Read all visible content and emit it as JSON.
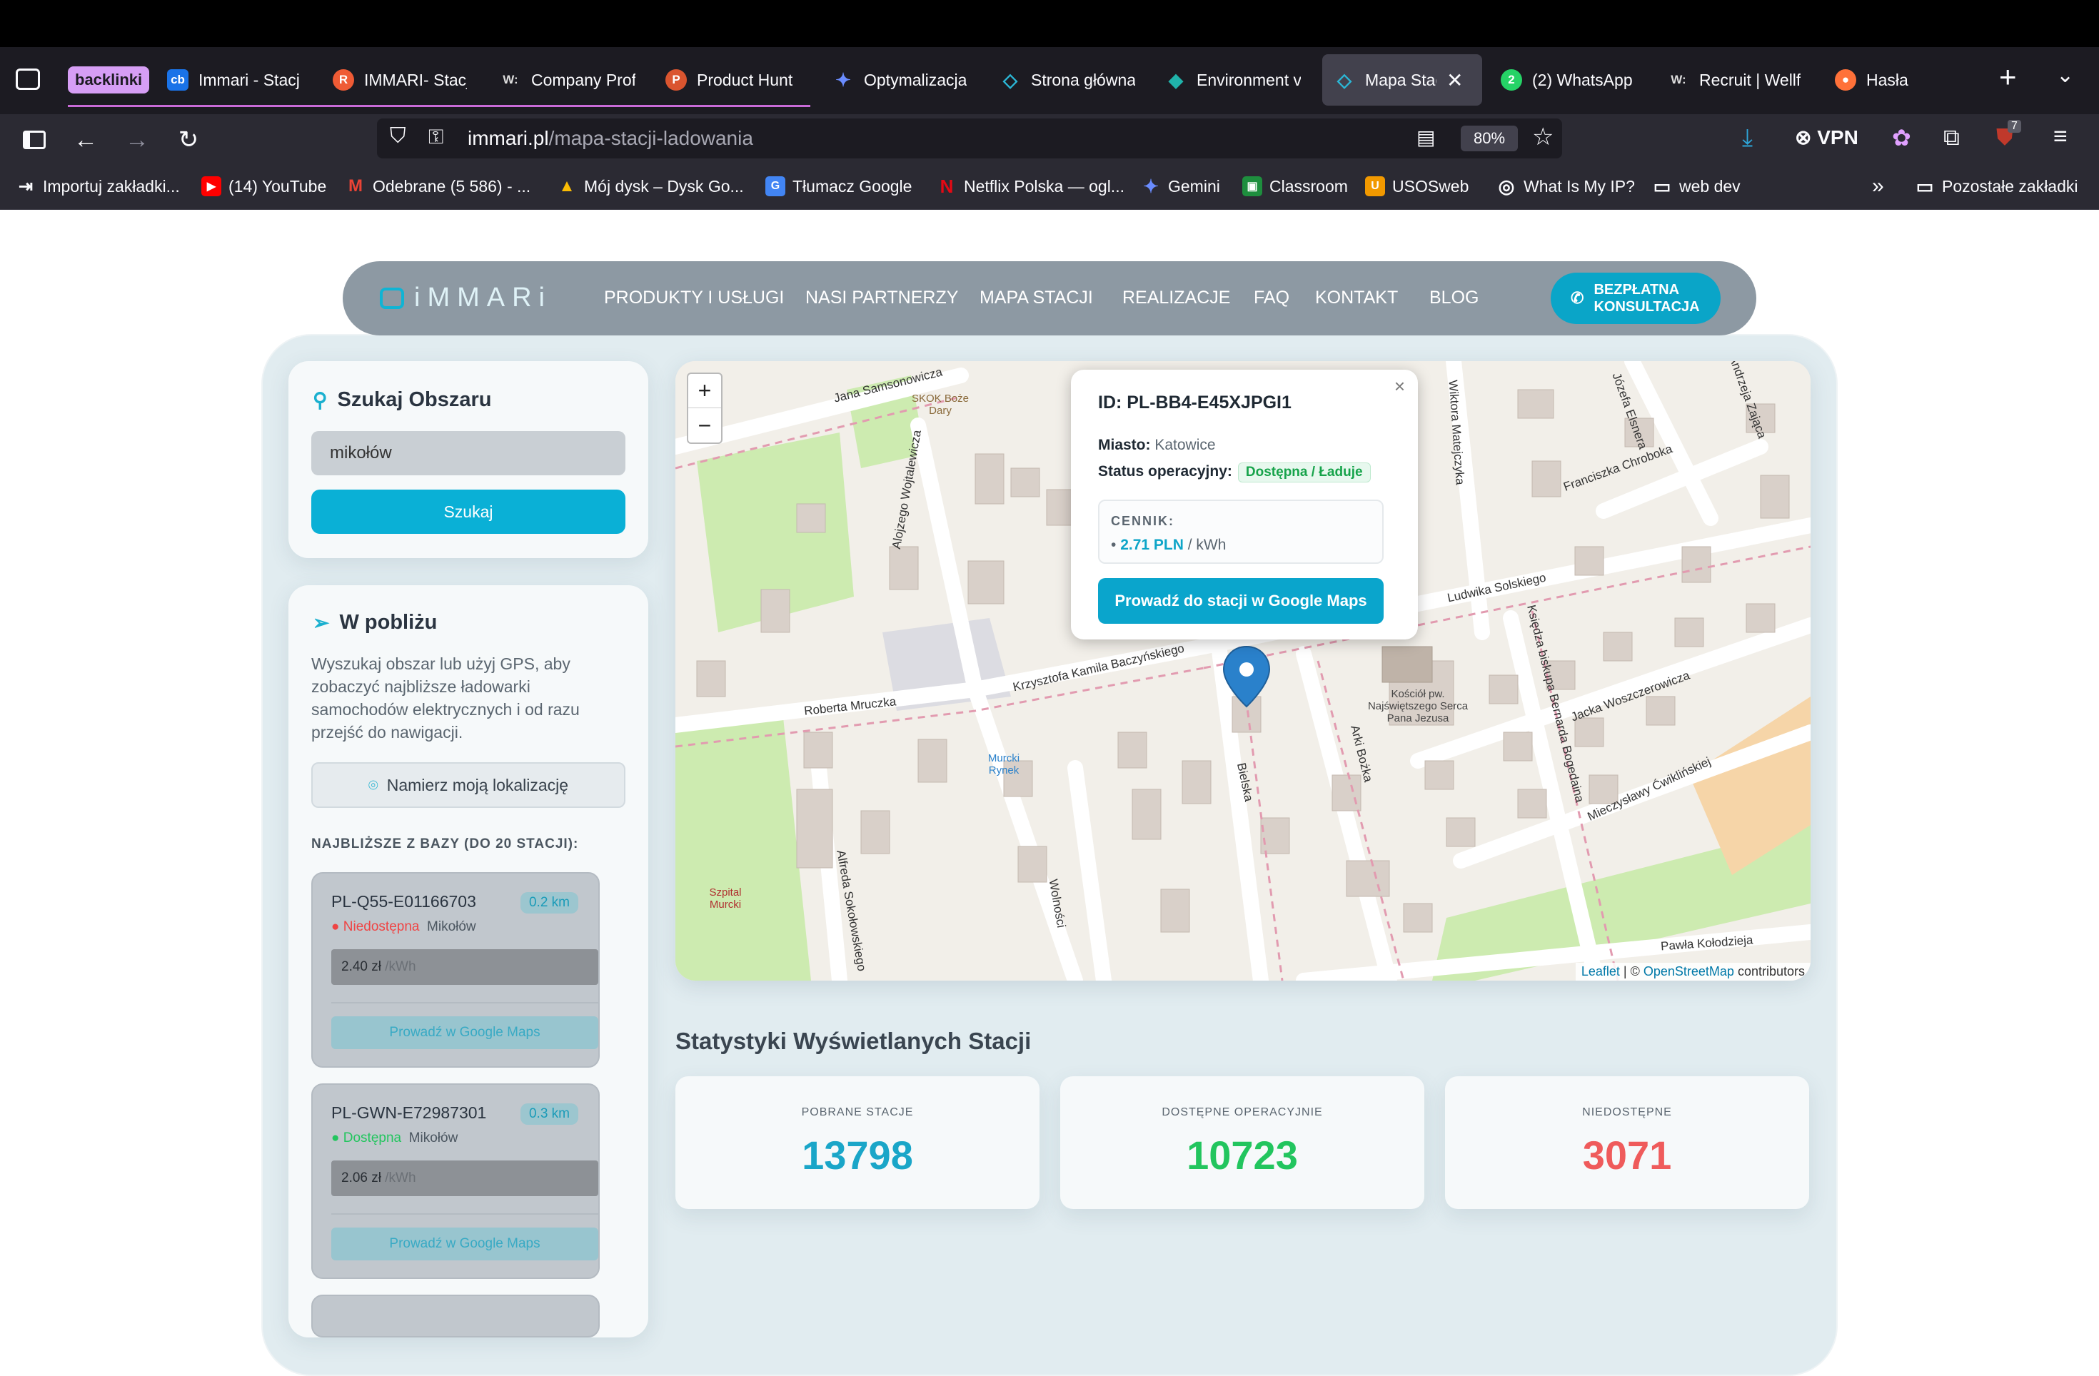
{
  "browser": {
    "tabs": [
      {
        "label": "backlinki",
        "type": "group",
        "color": "#d69ef5"
      },
      {
        "label": "Immari - Stacj",
        "icon": "cb",
        "color": "#1a73e8"
      },
      {
        "label": "IMMARI- Stacj",
        "icon": "R",
        "color": "#ef5b35"
      },
      {
        "label": "Company Prof",
        "icon": "W:",
        "color": "#222222"
      },
      {
        "label": "Product Hunt",
        "icon": "P",
        "color": "#da552f"
      },
      {
        "label": "Optymalizacja",
        "icon": "✦",
        "color": "#4285f4"
      },
      {
        "label": "Strona główna",
        "icon": "◇",
        "color": "#2bb7d6"
      },
      {
        "label": "Environment v",
        "icon": "◆",
        "color": "#20b2aa"
      },
      {
        "label": "Mapa Stacji",
        "icon": "◇",
        "color": "#2bb7d6",
        "active": true
      },
      {
        "label": "(2) WhatsApp",
        "icon": "2",
        "color": "#25d366"
      },
      {
        "label": "Recruit | Wellf",
        "icon": "W:",
        "color": "#222222"
      },
      {
        "label": "Hasła",
        "icon": "●",
        "color": "#ff7139"
      }
    ],
    "url_domain": "immari.pl",
    "url_path": "/mapa-stacji-ladowania",
    "zoom": "80%",
    "vpn_label": "VPN",
    "notification_count": "7",
    "bookmarks": [
      {
        "label": "Importuj zakładki...",
        "icon": "⇥",
        "color": "transparent"
      },
      {
        "label": "(14) YouTube",
        "icon": "▶",
        "color": "#ff0000"
      },
      {
        "label": "Odebrane (5 586) - ...",
        "icon": "M",
        "color": "#ea4335"
      },
      {
        "label": "Mój dysk – Dysk Go...",
        "icon": "▲",
        "color": "#34a853"
      },
      {
        "label": "Tłumacz Google",
        "icon": "G",
        "color": "#4285f4"
      },
      {
        "label": "Netflix Polska — ogl...",
        "icon": "N",
        "color": "#e50914"
      },
      {
        "label": "Gemini",
        "icon": "✦",
        "color": "transparent"
      },
      {
        "label": "Classroom",
        "icon": "▣",
        "color": "#1e8e3e"
      },
      {
        "label": "USOSweb",
        "icon": "U",
        "color": "#f29900"
      },
      {
        "label": "What Is My IP?",
        "icon": "◎",
        "color": "transparent"
      },
      {
        "label": "web dev",
        "icon": "▭",
        "color": "transparent"
      }
    ],
    "other_bookmarks": "Pozostałe zakładki"
  },
  "site": {
    "logo": "iMMARi",
    "nav": [
      "PRODUKTY I USŁUGI",
      "NASI PARTNERZY",
      "MAPA STACJI",
      "REALIZACJE",
      "FAQ",
      "KONTAKT",
      "BLOG"
    ],
    "consult_line1": "BEZPŁATNA",
    "consult_line2": "KONSULTACJA"
  },
  "search": {
    "title": "Szukaj Obszaru",
    "value": "mikołów",
    "button": "Szukaj"
  },
  "nearby": {
    "title": "W pobliżu",
    "description": "Wyszukaj obszar lub użyj GPS, aby zobaczyć najbliższe ładowarki samochodów elektrycznych i od razu przejść do nawigacji.",
    "locate_button": "Namierz moją lokalizację",
    "list_header": "NAJBLIŻSZE Z BAZY (DO 20 STACJI):",
    "stations": [
      {
        "id": "PL-Q55-E01166703",
        "distance": "0.2 km",
        "status": "Niedostępna",
        "status_type": "unavailable",
        "city": "Mikołów",
        "price": "2.40 zł",
        "unit": "/kWh",
        "button": "Prowadź w Google Maps"
      },
      {
        "id": "PL-GWN-E72987301",
        "distance": "0.3 km",
        "status": "Dostępna",
        "status_type": "available",
        "city": "Mikołów",
        "price": "2.06 zł",
        "unit": "/kWh",
        "button": "Prowadź w Google Maps"
      }
    ]
  },
  "map": {
    "zoom_in": "+",
    "zoom_out": "−",
    "attribution_leaflet": "Leaflet",
    "attribution_sep": "| ©",
    "attribution_osm": "OpenStreetMap",
    "attribution_tail": "contributors",
    "streets": [
      "Jana Samsonowicza",
      "Alojzego Wojtalewicza",
      "Roberta Mruczka",
      "Krzysztofa Kamila Baczyńskiego",
      "Bielska",
      "Arki Bożka",
      "Ludwika Solskiego",
      "Księdza biskupa Bernarda Bogedaina",
      "Jacka Woszczerowicza",
      "Mieczysławy Ćwiklińskiej",
      "Franciszka Chrobokа",
      "Józefa Elsnera",
      "Andrzeja Zająca",
      "Wiktora Matejczyka",
      "Wolności",
      "Alfreda Sokołowskiego",
      "Pawła Kołodzieja"
    ],
    "poi": [
      "SKOK Boże Dary",
      "Murcki Rynek",
      "Szpital Murcki",
      "Kościół pw. Najświętszego Serca Pana Jezusa"
    ]
  },
  "popup": {
    "id": "ID: PL-BB4-E45XJPGI1",
    "city_label": "Miasto:",
    "city": "Katowice",
    "status_label": "Status operacyjny:",
    "status": "Dostępna / Ładuje",
    "pricing_label": "CENNIK:",
    "price": "2.71 PLN",
    "unit": "/ kWh",
    "button": "Prowadź do stacji w Google Maps",
    "close": "×"
  },
  "stats": {
    "title": "Statystyki Wyświetlanych Stacji",
    "cards": [
      {
        "label": "POBRANE STACJE",
        "value": "13798",
        "color": "#1aa6c8"
      },
      {
        "label": "DOSTĘPNE OPERACYJNIE",
        "value": "10723",
        "color": "#22c55e"
      },
      {
        "label": "NIEDOSTĘPNE",
        "value": "3071",
        "color": "#ef5b5b"
      }
    ]
  }
}
